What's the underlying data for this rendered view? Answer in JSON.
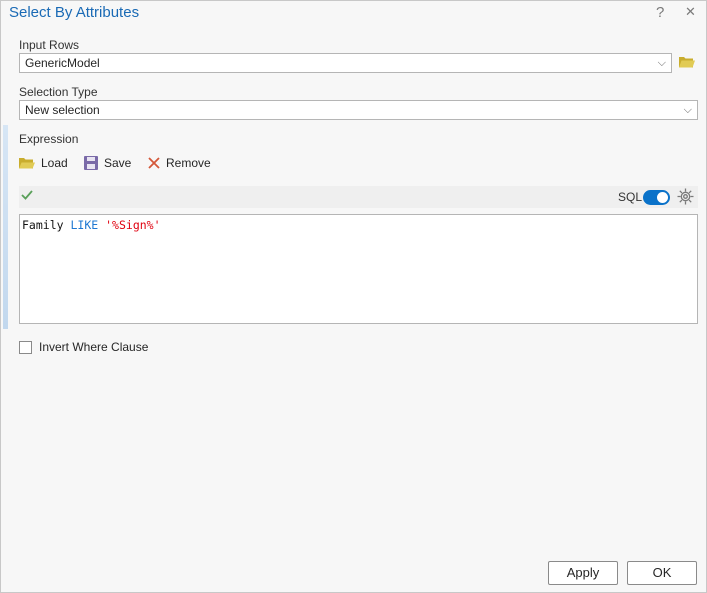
{
  "window": {
    "title": "Select By Attributes",
    "help": "?",
    "close": "✕"
  },
  "input_rows": {
    "label": "Input Rows",
    "value": "GenericModel"
  },
  "selection_type": {
    "label": "Selection Type",
    "value": "New selection"
  },
  "expression": {
    "label": "Expression",
    "load": "Load",
    "save": "Save",
    "remove": "Remove",
    "sql_label": "SQL",
    "sql_enabled": true,
    "code": {
      "field": "Family",
      "operator": "LIKE",
      "value": "'%Sign%'"
    }
  },
  "invert": {
    "label": "Invert Where Clause",
    "checked": false
  },
  "footer": {
    "apply": "Apply",
    "ok": "OK"
  },
  "colors": {
    "accent": "#1a6ab5",
    "toggle": "#0a72c9",
    "keyword": "#1e78d2",
    "string": "#e0000f",
    "folder": "#d8c14a"
  }
}
